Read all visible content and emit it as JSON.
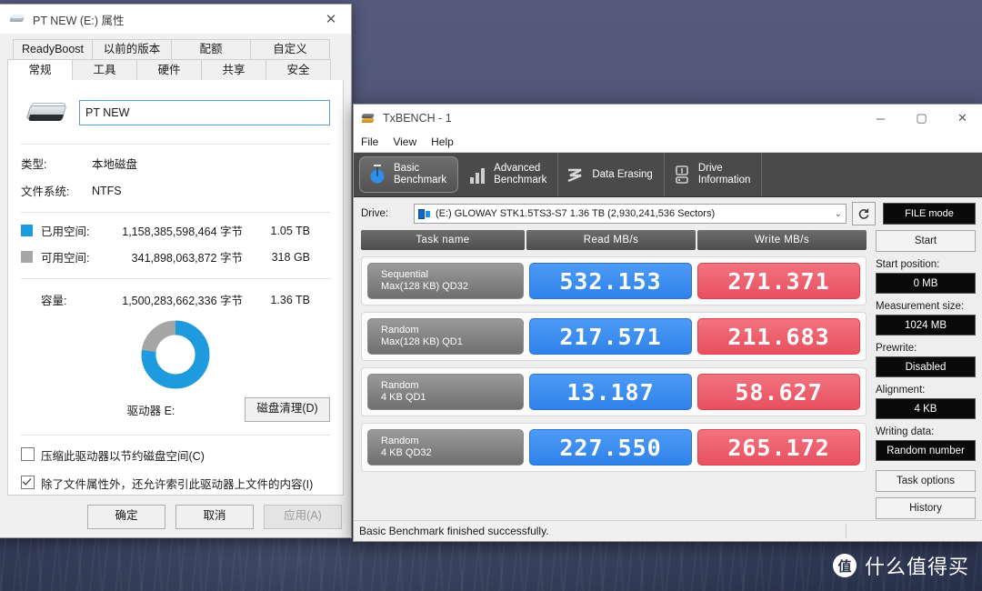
{
  "properties_dialog": {
    "title": "PT NEW (E:) 属性",
    "close_label": "✕",
    "tabs_row1": [
      "ReadyBoost",
      "以前的版本",
      "配额",
      "自定义"
    ],
    "tabs_row2": [
      "常规",
      "工具",
      "硬件",
      "共享",
      "安全"
    ],
    "volume_name": "PT NEW",
    "type_label": "类型:",
    "type_value": "本地磁盘",
    "fs_label": "文件系统:",
    "fs_value": "NTFS",
    "used_label": "已用空间:",
    "used_bytes": "1,158,385,598,464 字节",
    "used_human": "1.05 TB",
    "free_label": "可用空间:",
    "free_bytes": "341,898,063,872 字节",
    "free_human": "318 GB",
    "capacity_label": "容量:",
    "capacity_bytes": "1,500,283,662,336 字节",
    "capacity_human": "1.36 TB",
    "drive_line": "驱动器 E:",
    "cleanup_button": "磁盘清理(D)",
    "checkbox_compress": "压缩此驱动器以节约磁盘空间(C)",
    "checkbox_index": "除了文件属性外，还允许索引此驱动器上文件的内容(I)",
    "ok_button": "确定",
    "cancel_button": "取消",
    "apply_button": "应用(A)",
    "used_color": "#1e9ade",
    "free_color": "#a6a6a6",
    "used_percent": 77
  },
  "txbench": {
    "title": "TxBENCH - 1",
    "minimize": "─",
    "maximize": "▢",
    "close": "✕",
    "menu": [
      "File",
      "View",
      "Help"
    ],
    "tabs": [
      {
        "label_line1": "Basic",
        "label_line2": "Benchmark",
        "icon": "stopwatch-icon",
        "active": true
      },
      {
        "label_line1": "Advanced",
        "label_line2": "Benchmark",
        "icon": "bar-chart-icon",
        "active": false
      },
      {
        "label_line1": "Data Erasing",
        "label_line2": "",
        "icon": "wave-icon",
        "active": false
      },
      {
        "label_line1": "Drive",
        "label_line2": "Information",
        "icon": "info-drive-icon",
        "active": false
      }
    ],
    "drive_label": "Drive:",
    "drive_value": "(E:) GLOWAY STK1.5TS3-S7  1.36 TB (2,930,241,536 Sectors)",
    "refresh_icon": "refresh-icon",
    "file_mode_button": "FILE mode",
    "columns": [
      "Task name",
      "Read MB/s",
      "Write MB/s"
    ],
    "rows": [
      {
        "task_line1": "Sequential",
        "task_line2": "Max(128 KB) QD32",
        "read": "532.153",
        "write": "271.371"
      },
      {
        "task_line1": "Random",
        "task_line2": "Max(128 KB) QD1",
        "read": "217.571",
        "write": "211.683"
      },
      {
        "task_line1": "Random",
        "task_line2": "4 KB QD1",
        "read": "13.187",
        "write": "58.627"
      },
      {
        "task_line1": "Random",
        "task_line2": "4 KB QD32",
        "read": "227.550",
        "write": "265.172"
      }
    ],
    "side": {
      "start_button": "Start",
      "start_position_label": "Start position:",
      "start_position_value": "0 MB",
      "measurement_size_label": "Measurement size:",
      "measurement_size_value": "1024 MB",
      "prewrite_label": "Prewrite:",
      "prewrite_value": "Disabled",
      "alignment_label": "Alignment:",
      "alignment_value": "4 KB",
      "writing_data_label": "Writing data:",
      "writing_data_value": "Random number",
      "task_options_button": "Task options",
      "history_button": "History"
    },
    "status": "Basic Benchmark finished successfully.",
    "read_color": "#3b8ef0",
    "write_color": "#ec5462"
  },
  "watermark": {
    "logo_char": "值",
    "text": "什么值得买"
  }
}
